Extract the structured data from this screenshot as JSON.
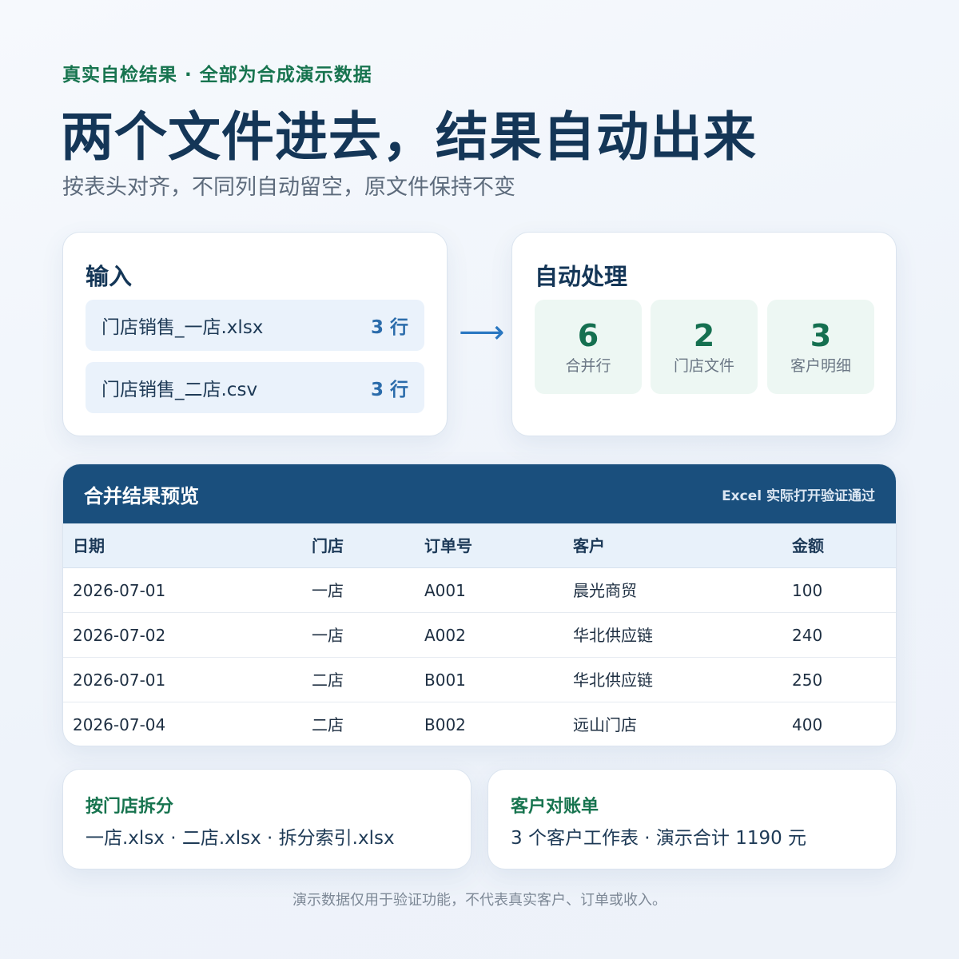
{
  "header": {
    "eyebrow": "真实自检结果 · 全部为合成演示数据",
    "title": "两个文件进去，结果自动出来",
    "subtitle": "按表头对齐，不同列自动留空，原文件保持不变"
  },
  "input_panel": {
    "heading": "输入",
    "files": [
      {
        "name": "门店销售_一店.xlsx",
        "count": "3 行"
      },
      {
        "name": "门店销售_二店.csv",
        "count": "3 行"
      }
    ]
  },
  "arrow_icon": "right-arrow",
  "auto_panel": {
    "heading": "自动处理",
    "stats": [
      {
        "value": "6",
        "label": "合并行"
      },
      {
        "value": "2",
        "label": "门店文件"
      },
      {
        "value": "3",
        "label": "客户明细"
      }
    ]
  },
  "preview": {
    "title": "合并结果预览",
    "badge": "Excel 实际打开验证通过",
    "columns": [
      "日期",
      "门店",
      "订单号",
      "客户",
      "金额"
    ],
    "rows": [
      [
        "2026-07-01",
        "一店",
        "A001",
        "晨光商贸",
        "100"
      ],
      [
        "2026-07-02",
        "一店",
        "A002",
        "华北供应链",
        "240"
      ],
      [
        "2026-07-01",
        "二店",
        "B001",
        "华北供应链",
        "250"
      ],
      [
        "2026-07-04",
        "二店",
        "B002",
        "远山门店",
        "400"
      ]
    ]
  },
  "split_card": {
    "title": "按门店拆分",
    "body": "一店.xlsx · 二店.xlsx · 拆分索引.xlsx"
  },
  "recon_card": {
    "title": "客户对账单",
    "body": "3 个客户工作表 · 演示合计 1190 元"
  },
  "footer": "演示数据仅用于验证功能，不代表真实客户、订单或收入。",
  "colors": {
    "accent_green": "#17744f",
    "title_navy": "#143657",
    "table_header": "#1a4f7d",
    "file_row_bg": "#eaf2fb",
    "stat_bg": "#edf7f3"
  }
}
